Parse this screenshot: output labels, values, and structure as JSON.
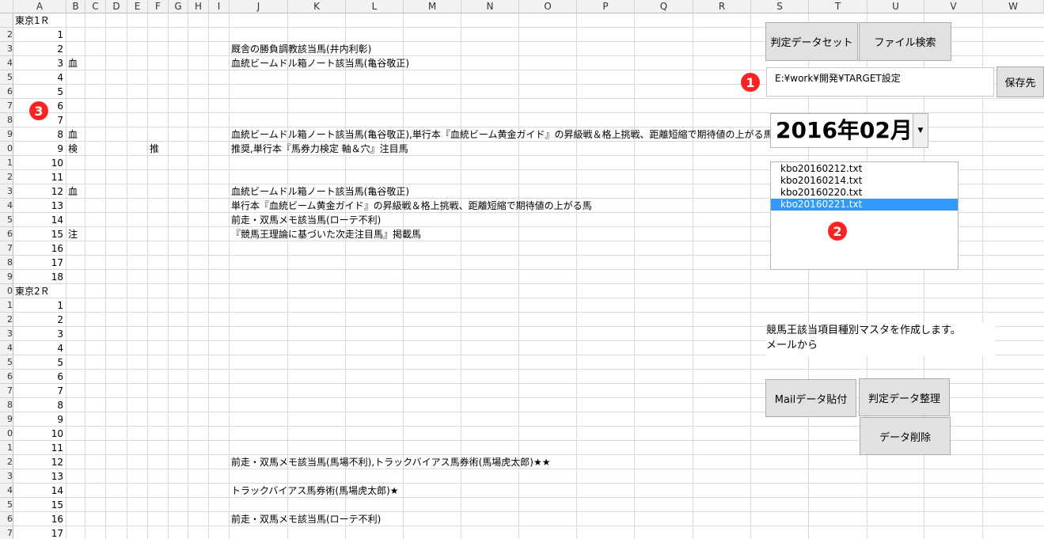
{
  "columns": [
    "A",
    "B",
    "C",
    "D",
    "E",
    "F",
    "G",
    "H",
    "I",
    "J",
    "K",
    "L",
    "M",
    "N",
    "O",
    "P",
    "Q",
    "R",
    "S",
    "T",
    "U",
    "V",
    "W"
  ],
  "row_numbers": [
    "",
    "2",
    "3",
    "4",
    "5",
    "6",
    "7",
    "8",
    "9",
    "0",
    "1",
    "2",
    "3",
    "4",
    "5",
    "6",
    "7",
    "8",
    "9",
    "0",
    "1",
    "2",
    "3",
    "4",
    "5",
    "6",
    "7",
    "8",
    "9",
    "0",
    "1",
    "2",
    "3",
    "4",
    "5",
    "6",
    "7"
  ],
  "cells": [
    {
      "row": 0,
      "col": "A",
      "value": "東京1Ｒ",
      "align": "left"
    },
    {
      "row": 1,
      "col": "A",
      "value": "1",
      "align": "right"
    },
    {
      "row": 2,
      "col": "A",
      "value": "2",
      "align": "right"
    },
    {
      "row": 2,
      "col": "J",
      "value": "厩舎の勝負調教該当馬(井内利彰)",
      "align": "left"
    },
    {
      "row": 3,
      "col": "A",
      "value": "3",
      "align": "right"
    },
    {
      "row": 3,
      "col": "B",
      "value": "血",
      "align": "left"
    },
    {
      "row": 3,
      "col": "J",
      "value": "血統ビームドル箱ノート該当馬(亀谷敬正)",
      "align": "left"
    },
    {
      "row": 4,
      "col": "A",
      "value": "4",
      "align": "right"
    },
    {
      "row": 5,
      "col": "A",
      "value": "5",
      "align": "right"
    },
    {
      "row": 6,
      "col": "A",
      "value": "6",
      "align": "right"
    },
    {
      "row": 7,
      "col": "A",
      "value": "7",
      "align": "right"
    },
    {
      "row": 8,
      "col": "A",
      "value": "8",
      "align": "right"
    },
    {
      "row": 8,
      "col": "B",
      "value": "血",
      "align": "left"
    },
    {
      "row": 8,
      "col": "J",
      "value": "血統ビームドル箱ノート該当馬(亀谷敬正),単行本『血統ビーム黄金ガイド』の昇級戦＆格上挑戦、距離短縮で期待値の上がる馬",
      "align": "left"
    },
    {
      "row": 9,
      "col": "A",
      "value": "9",
      "align": "right"
    },
    {
      "row": 9,
      "col": "B",
      "value": "検",
      "align": "left"
    },
    {
      "row": 9,
      "col": "F",
      "value": "推",
      "align": "left"
    },
    {
      "row": 9,
      "col": "J",
      "value": "推奨,単行本『馬券力検定 軸＆穴』注目馬",
      "align": "left"
    },
    {
      "row": 10,
      "col": "A",
      "value": "10",
      "align": "right"
    },
    {
      "row": 11,
      "col": "A",
      "value": "11",
      "align": "right"
    },
    {
      "row": 12,
      "col": "A",
      "value": "12",
      "align": "right"
    },
    {
      "row": 12,
      "col": "B",
      "value": "血",
      "align": "left"
    },
    {
      "row": 12,
      "col": "J",
      "value": "血統ビームドル箱ノート該当馬(亀谷敬正)",
      "align": "left"
    },
    {
      "row": 13,
      "col": "A",
      "value": "13",
      "align": "right"
    },
    {
      "row": 13,
      "col": "J",
      "value": "単行本『血統ビーム黄金ガイド』の昇級戦＆格上挑戦、距離短縮で期待値の上がる馬",
      "align": "left"
    },
    {
      "row": 14,
      "col": "A",
      "value": "14",
      "align": "right"
    },
    {
      "row": 14,
      "col": "J",
      "value": "前走・双馬メモ該当馬(ローテ不利)",
      "align": "left"
    },
    {
      "row": 15,
      "col": "A",
      "value": "15",
      "align": "right"
    },
    {
      "row": 15,
      "col": "B",
      "value": "注",
      "align": "left"
    },
    {
      "row": 15,
      "col": "J",
      "value": "『競馬王理論に基づいた次走注目馬』掲載馬",
      "align": "left"
    },
    {
      "row": 16,
      "col": "A",
      "value": "16",
      "align": "right"
    },
    {
      "row": 17,
      "col": "A",
      "value": "17",
      "align": "right"
    },
    {
      "row": 18,
      "col": "A",
      "value": "18",
      "align": "right"
    },
    {
      "row": 19,
      "col": "A",
      "value": "東京2Ｒ",
      "align": "left"
    },
    {
      "row": 20,
      "col": "A",
      "value": "1",
      "align": "right"
    },
    {
      "row": 21,
      "col": "A",
      "value": "2",
      "align": "right"
    },
    {
      "row": 22,
      "col": "A",
      "value": "3",
      "align": "right"
    },
    {
      "row": 23,
      "col": "A",
      "value": "4",
      "align": "right"
    },
    {
      "row": 24,
      "col": "A",
      "value": "5",
      "align": "right"
    },
    {
      "row": 25,
      "col": "A",
      "value": "6",
      "align": "right"
    },
    {
      "row": 26,
      "col": "A",
      "value": "7",
      "align": "right"
    },
    {
      "row": 27,
      "col": "A",
      "value": "8",
      "align": "right"
    },
    {
      "row": 28,
      "col": "A",
      "value": "9",
      "align": "right"
    },
    {
      "row": 29,
      "col": "A",
      "value": "10",
      "align": "right"
    },
    {
      "row": 30,
      "col": "A",
      "value": "11",
      "align": "right"
    },
    {
      "row": 31,
      "col": "A",
      "value": "12",
      "align": "right"
    },
    {
      "row": 31,
      "col": "J",
      "value": "前走・双馬メモ該当馬(馬場不利),トラックバイアス馬券術(馬場虎太郎)★★",
      "align": "left"
    },
    {
      "row": 32,
      "col": "A",
      "value": "13",
      "align": "right"
    },
    {
      "row": 33,
      "col": "A",
      "value": "14",
      "align": "right"
    },
    {
      "row": 33,
      "col": "J",
      "value": "トラックバイアス馬券術(馬場虎太郎)★",
      "align": "left"
    },
    {
      "row": 34,
      "col": "A",
      "value": "15",
      "align": "right"
    },
    {
      "row": 35,
      "col": "A",
      "value": "16",
      "align": "right"
    },
    {
      "row": 35,
      "col": "J",
      "value": "前走・双馬メモ該当馬(ローテ不利)",
      "align": "left"
    },
    {
      "row": 36,
      "col": "A",
      "value": "17",
      "align": "right"
    }
  ],
  "buttons": {
    "judge_data_set": "判定データセット",
    "file_search": "ファイル検索",
    "save_dest": "保存先",
    "mail_paste": "Mailデータ貼付",
    "judge_organize": "判定データ整理",
    "data_delete": "データ削除"
  },
  "path_box": {
    "value": "E:¥work¥開発¥TARGET設定"
  },
  "month_select": {
    "value": "2016年02月"
  },
  "file_list": {
    "items": [
      "kbo20160212.txt",
      "kbo20160214.txt",
      "kbo20160220.txt",
      "kbo20160221.txt"
    ],
    "selected_index": 3
  },
  "note": {
    "line1": "競馬王該当項目種別マスタを作成します。",
    "line2": "メールから"
  },
  "markers": {
    "m1": "1",
    "m2": "2",
    "m3": "3"
  },
  "colors": {
    "selection": "#3399ff",
    "marker": "#ff2222",
    "header_bg": "#f2f2f2"
  }
}
